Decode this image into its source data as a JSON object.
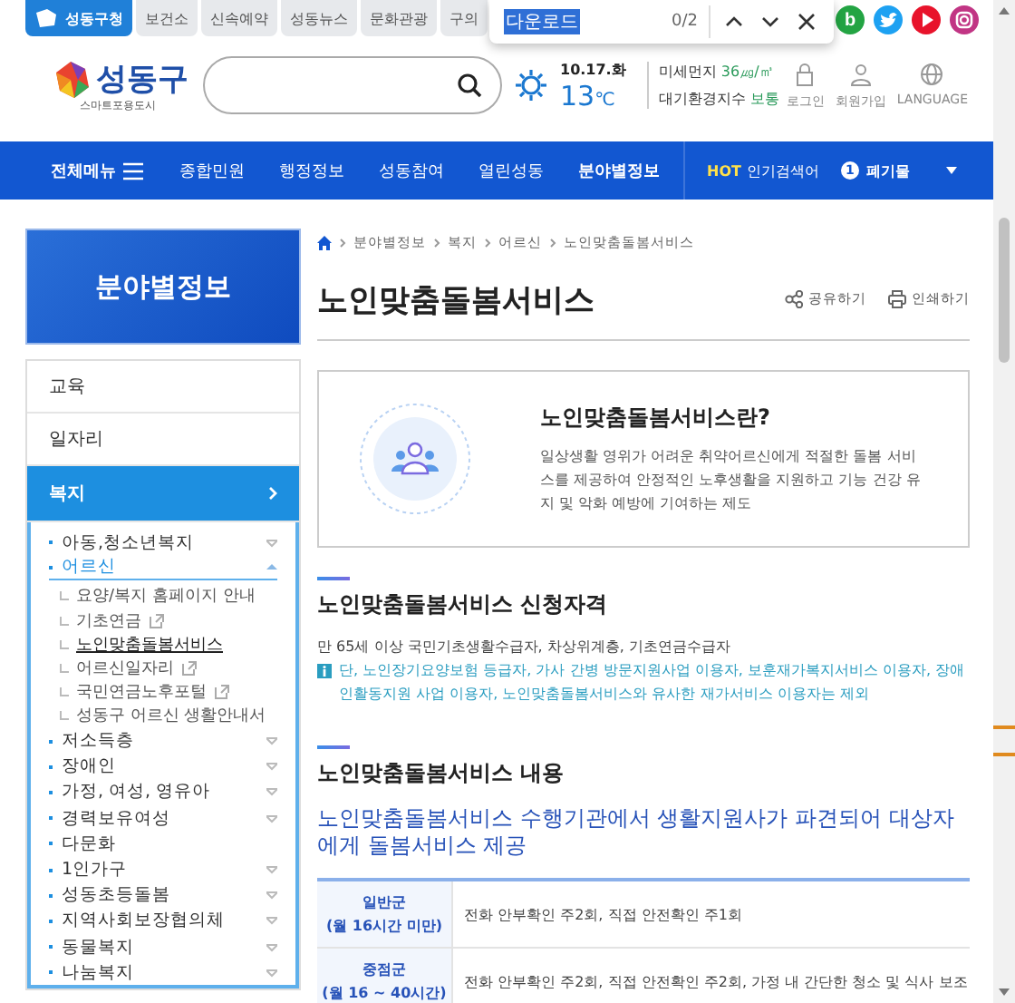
{
  "top_tabs": [
    {
      "label": "성동구청",
      "selected": true
    },
    {
      "label": "보건소",
      "selected": false
    },
    {
      "label": "신속예약",
      "selected": false
    },
    {
      "label": "성동뉴스",
      "selected": false
    },
    {
      "label": "문화관광",
      "selected": false
    },
    {
      "label": "구의",
      "selected": false
    }
  ],
  "social_links": [
    {
      "kind": "blog",
      "label": "b"
    },
    {
      "kind": "twitter"
    },
    {
      "kind": "youtube"
    },
    {
      "kind": "instagram"
    }
  ],
  "find_bar": {
    "query": "다운로드",
    "count": "0/2"
  },
  "logo": {
    "name": "성동구",
    "tagline": "스마트포용도시"
  },
  "weather": {
    "date": "10.17.화",
    "temp": "13",
    "unit": "℃"
  },
  "air": [
    {
      "label": "미세먼지",
      "value": "36㎍/㎥"
    },
    {
      "label": "대기환경지수",
      "value": "보통"
    }
  ],
  "utilities": [
    {
      "kind": "lock",
      "label": "로그인"
    },
    {
      "kind": "person",
      "label": "회원가입"
    },
    {
      "kind": "globe",
      "label": "LANGUAGE"
    }
  ],
  "nav": {
    "all_menu": "전체메뉴",
    "items": [
      {
        "label": "종합민원",
        "selected": false
      },
      {
        "label": "행정정보",
        "selected": false
      },
      {
        "label": "성동참여",
        "selected": false
      },
      {
        "label": "열린성동",
        "selected": false
      },
      {
        "label": "분야별정보",
        "selected": true
      }
    ],
    "hot": {
      "tag": "HOT",
      "label": "인기검색어",
      "rank": "1",
      "keyword": "폐기물"
    }
  },
  "sidebar": {
    "title": "분야별정보",
    "items": [
      {
        "label": "교육",
        "selected": false
      },
      {
        "label": "일자리",
        "selected": false
      },
      {
        "label": "복지",
        "selected": true,
        "children": [
          {
            "label": "아동,청소년복지",
            "expanded": false,
            "selected": false
          },
          {
            "label": "어르신",
            "expanded": true,
            "selected": true,
            "children": [
              {
                "label": "요양/복지 홈페이지 안내",
                "external": false,
                "selected": false
              },
              {
                "label": "기초연금",
                "external": true,
                "selected": false
              },
              {
                "label": "노인맞춤돌봄서비스",
                "external": false,
                "selected": true
              },
              {
                "label": "어르신일자리",
                "external": true,
                "selected": false
              },
              {
                "label": "국민연금노후포털",
                "external": true,
                "selected": false
              },
              {
                "label": "성동구 어르신 생활안내서",
                "external": false,
                "selected": false
              }
            ]
          },
          {
            "label": "저소득층",
            "expanded": false,
            "selected": false
          },
          {
            "label": "장애인",
            "expanded": false,
            "selected": false
          },
          {
            "label": "가정, 여성, 영유아",
            "expanded": false,
            "selected": false
          },
          {
            "label": "경력보유여성",
            "expanded": false,
            "selected": false
          },
          {
            "label": "다문화",
            "selected": false
          },
          {
            "label": "1인가구",
            "expanded": false,
            "selected": false
          },
          {
            "label": "성동초등돌봄",
            "expanded": false,
            "selected": false
          },
          {
            "label": "지역사회보장협의체",
            "expanded": false,
            "selected": false
          },
          {
            "label": "동물복지",
            "expanded": false,
            "selected": false
          },
          {
            "label": "나눔복지",
            "expanded": false,
            "selected": false
          }
        ]
      }
    ]
  },
  "breadcrumb": [
    "분야별정보",
    "복지",
    "어르신",
    "노인맞춤돌봄서비스"
  ],
  "page_title": "노인맞춤돌봄서비스",
  "actions": [
    {
      "kind": "share",
      "label": "공유하기"
    },
    {
      "kind": "print",
      "label": "인쇄하기"
    }
  ],
  "intro": {
    "title": "노인맞춤돌봄서비스란?",
    "text": "일상생활 영위가 어려운 취약어르신에게 적절한 돌봄 서비스를 제공하여 안정적인 노후생활을 지원하고 기능 건강 유지 및 악화 예방에 기여하는 제도"
  },
  "eligibility": {
    "heading": "노인맞춤돌봄서비스 신청자격",
    "text": "만 65세 이상 국민기초생활수급자, 차상위계층, 기초연금수급자",
    "note": "단, 노인장기요양보험 등급자, 가사 간병 방문지원사업 이용자, 보훈재가복지서비스 이용자, 장애인활동지원 사업 이용자, 노인맞춤돌봄서비스와 유사한 재가서비스 이용자는 제외"
  },
  "content": {
    "heading": "노인맞춤돌봄서비스 내용",
    "lead": "노인맞춤돌봄서비스 수행기관에서 생활지원사가 파견되어 대상자에게 돌봄서비스 제공",
    "rows": [
      {
        "group": "일반군",
        "hours": "(월 16시간 미만)",
        "detail": "전화 안부확인 주2회, 직접 안전확인 주1회"
      },
      {
        "group": "중점군",
        "hours": "(월 16 ~ 40시간)",
        "detail": "전화 안부확인 주2회, 직접 안전확인 주2회, 가정 내 간단한 청소 및 식사 보조"
      }
    ]
  }
}
